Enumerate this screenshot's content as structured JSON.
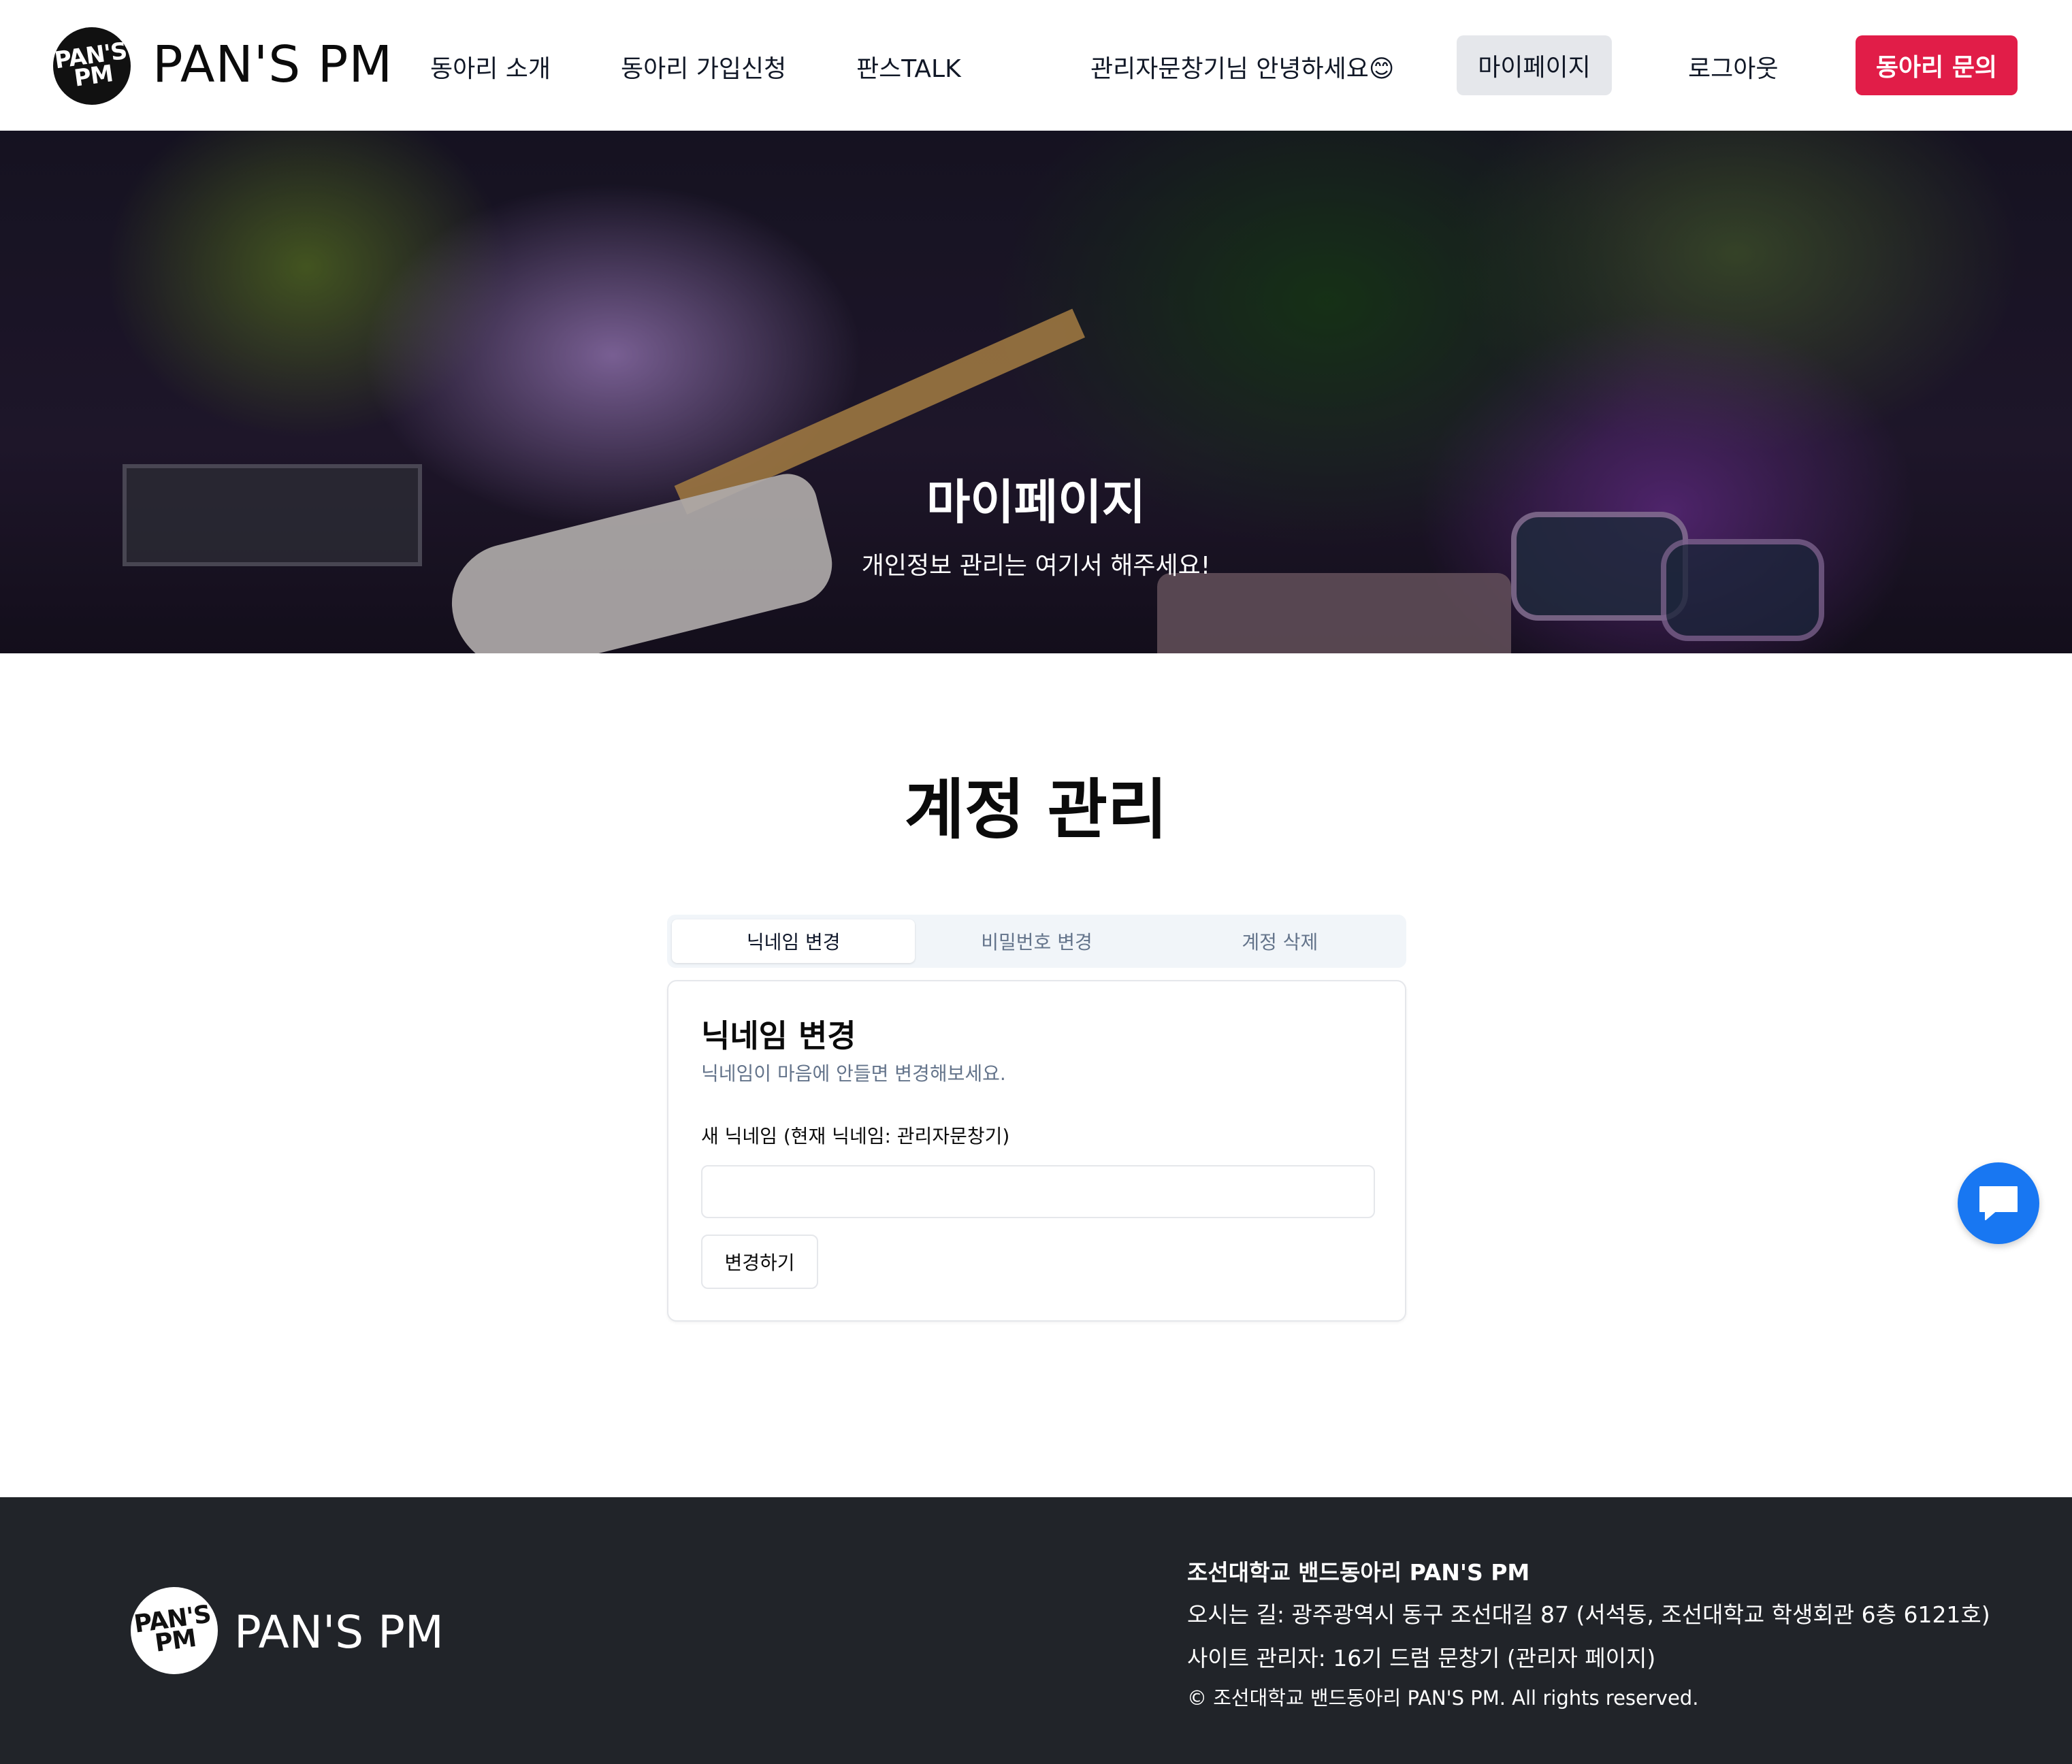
{
  "nav": {
    "logo_text": "PAN'S PM",
    "logo_mark": "PAN'S PM",
    "brand": "PAN'S PM",
    "links": [
      "동아리 소개",
      "동아리 가입신청",
      "판스TALK"
    ],
    "greeting": "관리자문창기님 안녕하세요😊",
    "mypage": "마이페이지",
    "logout": "로그아웃",
    "inquiry": "동아리 문의"
  },
  "hero": {
    "title": "마이페이지",
    "subtitle": "개인정보 관리는 여기서 해주세요!"
  },
  "main": {
    "title": "계정 관리",
    "tabs": [
      {
        "label": "닉네임 변경",
        "active": true
      },
      {
        "label": "비밀번호 변경",
        "active": false
      },
      {
        "label": "계정 삭제",
        "active": false
      }
    ],
    "card": {
      "title": "닉네임 변경",
      "description": "닉네임이 마음에 안들면 변경해보세요.",
      "field_label": "새 닉네임 (현재 닉네임: 관리자문창기)",
      "input_value": "",
      "input_placeholder": "",
      "submit": "변경하기"
    }
  },
  "chat": {
    "icon": "chat-bubble-icon",
    "color": "#1877f2"
  },
  "footer": {
    "brand": "PAN'S PM",
    "org": "조선대학교 밴드동아리 PAN'S PM",
    "address": "오시는 길: 광주광역시 동구 조선대길 87 (서석동, 조선대학교 학생회관 6층 6121호)",
    "admin": "사이트 관리자: 16기 드럼 문창기  (관리자 페이지)",
    "copyright": "© 조선대학교 밴드동아리 PAN'S PM. All rights reserved."
  },
  "colors": {
    "accent": "#e11d48",
    "footer_bg": "#212429",
    "tab_bg": "#f1f5f9",
    "muted_text": "#64748b"
  }
}
